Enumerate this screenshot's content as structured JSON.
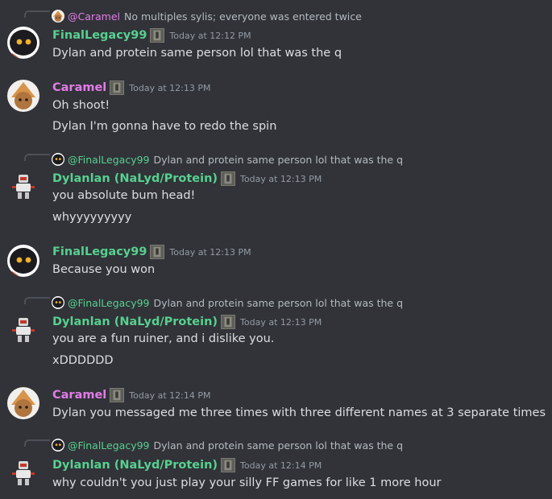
{
  "colors": {
    "background": "#313338",
    "finallegacy": "#57d08f",
    "caramel": "#e27ce8",
    "dylan": "#57d08f",
    "text": "#dbdee1",
    "muted": "#949ba4"
  },
  "messages": [
    {
      "reply": {
        "author": "@Caramel",
        "text": "No multiples sylis; everyone was entered twice",
        "avatar_icon": "doll-avatar-icon"
      },
      "author": "FinalLegacy99",
      "timestamp": "Today at 12:12 PM",
      "avatar_icon": "dark-mask-avatar-icon",
      "lines": [
        "Dylan and protein same person lol that was the q"
      ]
    },
    {
      "author": "Caramel",
      "timestamp": "Today at 12:13 PM",
      "avatar_icon": "doll-avatar-icon",
      "lines": [
        "Oh shoot!",
        "Dylan I'm gonna have to redo the spin"
      ]
    },
    {
      "reply": {
        "author": "@FinalLegacy99",
        "text": "Dylan and protein same person lol that was the q",
        "avatar_icon": "dark-mask-avatar-icon"
      },
      "author": "Dylanlan (NaLyd/Protein)",
      "timestamp": "Today at 12:13 PM",
      "avatar_icon": "robot-avatar-icon",
      "lines": [
        "you absolute bum head!",
        "whyyyyyyyyy"
      ]
    },
    {
      "author": "FinalLegacy99",
      "timestamp": "Today at 12:13 PM",
      "avatar_icon": "dark-mask-avatar-icon",
      "lines": [
        "Because you won"
      ]
    },
    {
      "reply": {
        "author": "@FinalLegacy99",
        "text": "Dylan and protein same person lol that was the q",
        "avatar_icon": "dark-mask-avatar-icon"
      },
      "author": "Dylanlan (NaLyd/Protein)",
      "timestamp": "Today at 12:13 PM",
      "avatar_icon": "robot-avatar-icon",
      "lines": [
        "you are a fun ruiner, and i dislike you.",
        "xDDDDDD"
      ]
    },
    {
      "author": "Caramel",
      "timestamp": "Today at 12:14 PM",
      "avatar_icon": "doll-avatar-icon",
      "lines": [
        "Dylan you messaged me three times with three different names at 3 separate times"
      ]
    },
    {
      "reply": {
        "author": "@FinalLegacy99",
        "text": "Dylan and protein same person lol that was the q",
        "avatar_icon": "dark-mask-avatar-icon"
      },
      "author": "Dylanlan (NaLyd/Protein)",
      "timestamp": "Today at 12:14 PM",
      "avatar_icon": "robot-avatar-icon",
      "lines": [
        "why couldn't you just play your silly FF games for like 1 more hour"
      ]
    }
  ]
}
